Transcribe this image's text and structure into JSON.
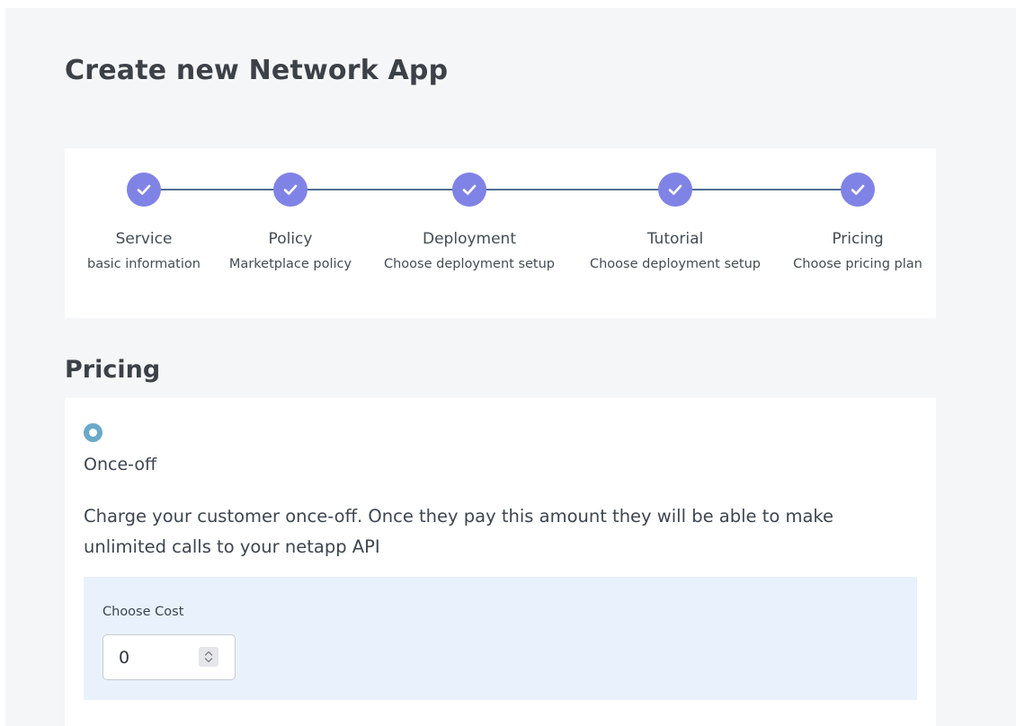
{
  "page": {
    "title": "Create new Network App"
  },
  "stepper": {
    "steps": [
      {
        "label": "Service",
        "sublabel": "basic information",
        "status": "completed",
        "icon": "check-icon"
      },
      {
        "label": "Policy",
        "sublabel": "Marketplace policy",
        "status": "completed",
        "icon": "check-icon"
      },
      {
        "label": "Deployment",
        "sublabel": "Choose deployment setup",
        "status": "completed",
        "icon": "check-icon"
      },
      {
        "label": "Tutorial",
        "sublabel": "Choose deployment setup",
        "status": "completed",
        "icon": "check-icon"
      },
      {
        "label": "Pricing",
        "sublabel": "Choose pricing plan",
        "status": "completed",
        "icon": "check-icon"
      }
    ],
    "completed_color": "#8083e6",
    "line_color": "#4f6e92"
  },
  "pricing": {
    "section_title": "Pricing",
    "option": {
      "label": "Once-off",
      "selected": true,
      "description": "Charge your customer once-off. Once they pay this amount they will be able to make unlimited calls to your netapp API"
    },
    "cost": {
      "label": "Choose Cost",
      "value": "0"
    }
  }
}
